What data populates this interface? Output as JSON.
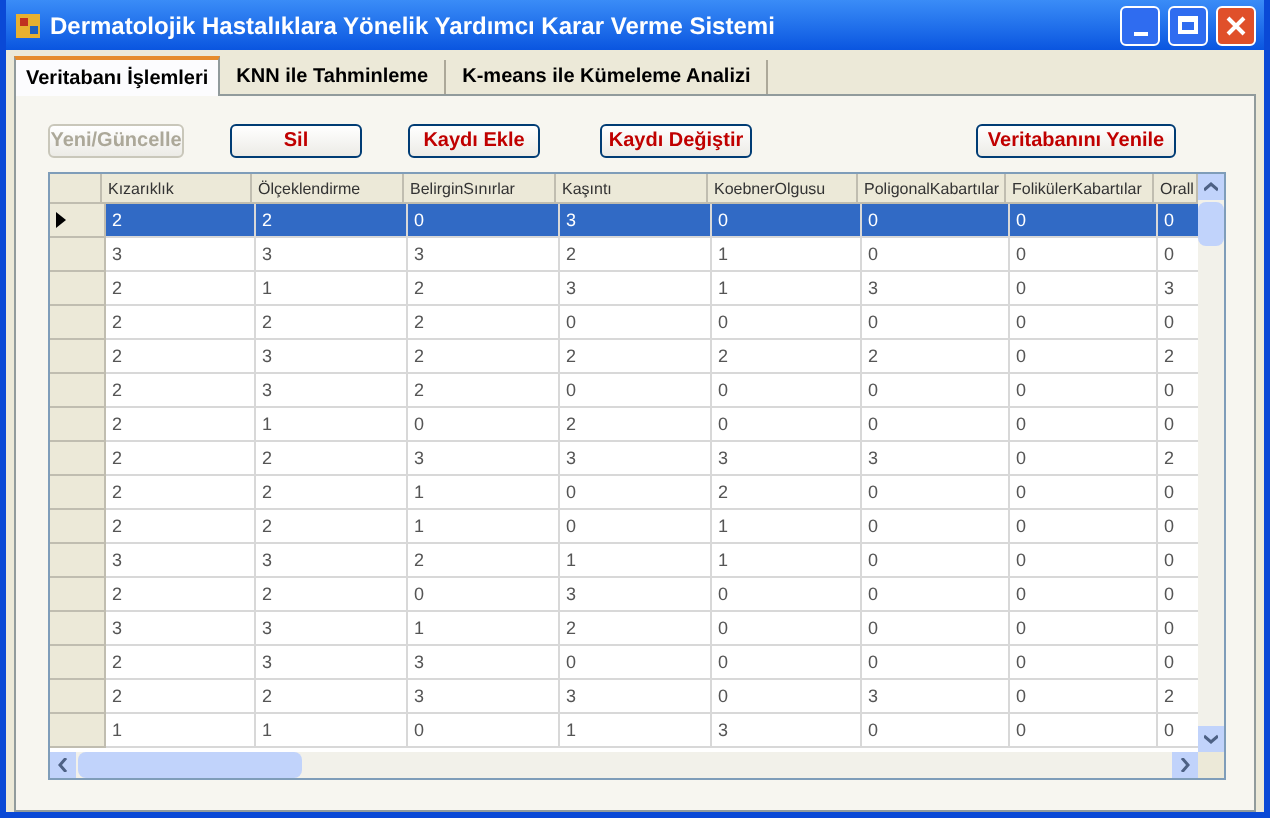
{
  "window": {
    "title": "Dermatolojik Hastalıklara Yönelik Yardımcı Karar Verme Sistemi"
  },
  "tabs": [
    {
      "label": "Veritabanı İşlemleri",
      "selected": true
    },
    {
      "label": "KNN ile Tahminleme",
      "selected": false
    },
    {
      "label": "K-means ile Kümeleme Analizi",
      "selected": false
    }
  ],
  "buttons": [
    {
      "label": "Yeni/Güncelle",
      "disabled": true
    },
    {
      "label": "Sil",
      "disabled": false
    },
    {
      "label": "Kaydı Ekle",
      "disabled": false
    },
    {
      "label": "Kaydı Değiştir",
      "disabled": false
    },
    {
      "label": "Veritabanını Yenile",
      "disabled": false
    }
  ],
  "table": {
    "columns": [
      "Kızarıklık",
      "Ölçeklendirme",
      "BelirginSınırlar",
      "Kaşıntı",
      "KoebnerOlgusu",
      "PoligonalKabartılar",
      "FolikülerKabartılar",
      "Orall"
    ],
    "rows": [
      {
        "selected": true,
        "cells": [
          "2",
          "2",
          "0",
          "3",
          "0",
          "0",
          "0",
          "0"
        ]
      },
      {
        "selected": false,
        "cells": [
          "3",
          "3",
          "3",
          "2",
          "1",
          "0",
          "0",
          "0"
        ]
      },
      {
        "selected": false,
        "cells": [
          "2",
          "1",
          "2",
          "3",
          "1",
          "3",
          "0",
          "3"
        ]
      },
      {
        "selected": false,
        "cells": [
          "2",
          "2",
          "2",
          "0",
          "0",
          "0",
          "0",
          "0"
        ]
      },
      {
        "selected": false,
        "cells": [
          "2",
          "3",
          "2",
          "2",
          "2",
          "2",
          "0",
          "2"
        ]
      },
      {
        "selected": false,
        "cells": [
          "2",
          "3",
          "2",
          "0",
          "0",
          "0",
          "0",
          "0"
        ]
      },
      {
        "selected": false,
        "cells": [
          "2",
          "1",
          "0",
          "2",
          "0",
          "0",
          "0",
          "0"
        ]
      },
      {
        "selected": false,
        "cells": [
          "2",
          "2",
          "3",
          "3",
          "3",
          "3",
          "0",
          "2"
        ]
      },
      {
        "selected": false,
        "cells": [
          "2",
          "2",
          "1",
          "0",
          "2",
          "0",
          "0",
          "0"
        ]
      },
      {
        "selected": false,
        "cells": [
          "2",
          "2",
          "1",
          "0",
          "1",
          "0",
          "0",
          "0"
        ]
      },
      {
        "selected": false,
        "cells": [
          "3",
          "3",
          "2",
          "1",
          "1",
          "0",
          "0",
          "0"
        ]
      },
      {
        "selected": false,
        "cells": [
          "2",
          "2",
          "0",
          "3",
          "0",
          "0",
          "0",
          "0"
        ]
      },
      {
        "selected": false,
        "cells": [
          "3",
          "3",
          "1",
          "2",
          "0",
          "0",
          "0",
          "0"
        ]
      },
      {
        "selected": false,
        "cells": [
          "2",
          "3",
          "3",
          "0",
          "0",
          "0",
          "0",
          "0"
        ]
      },
      {
        "selected": false,
        "cells": [
          "2",
          "2",
          "3",
          "3",
          "0",
          "3",
          "0",
          "2"
        ]
      },
      {
        "selected": false,
        "cells": [
          "1",
          "1",
          "0",
          "1",
          "3",
          "0",
          "0",
          "0"
        ]
      }
    ]
  }
}
